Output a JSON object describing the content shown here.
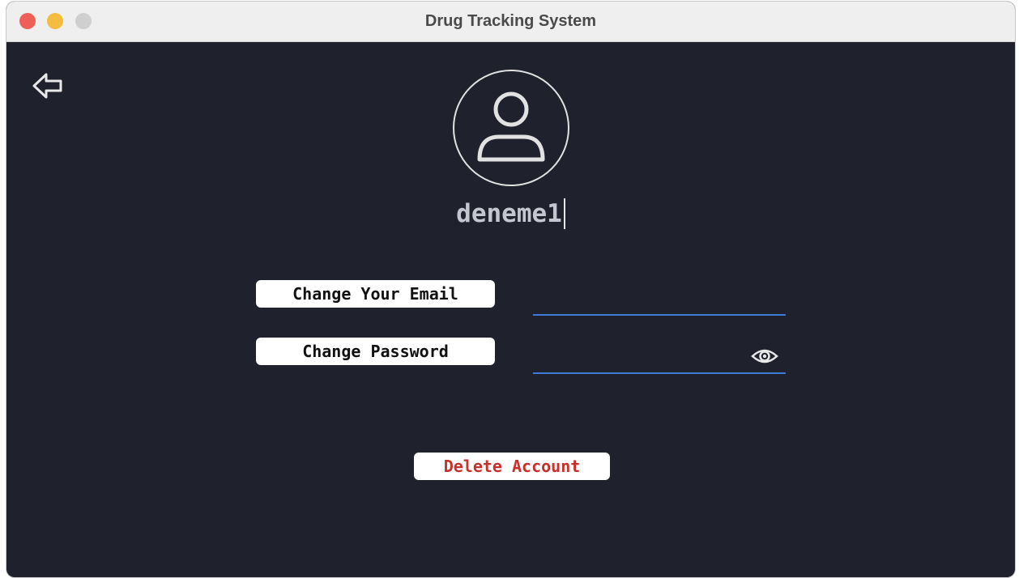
{
  "window": {
    "title": "Drug Tracking System"
  },
  "colors": {
    "background": "#1f212d",
    "accent": "#3d7bd9",
    "danger": "#c8302c",
    "traffic_close": "#ee5f57",
    "traffic_minimize": "#f5bc40",
    "traffic_zoom": "#cfcfcf"
  },
  "icons": {
    "back": "arrow-left-icon",
    "avatar": "user-icon",
    "visibility": "eye-icon"
  },
  "profile": {
    "username": "deneme1"
  },
  "actions": {
    "change_email_label": "Change Your Email",
    "change_password_label": "Change Password",
    "delete_account_label": "Delete Account"
  },
  "fields": {
    "email_value": "",
    "password_value": ""
  }
}
